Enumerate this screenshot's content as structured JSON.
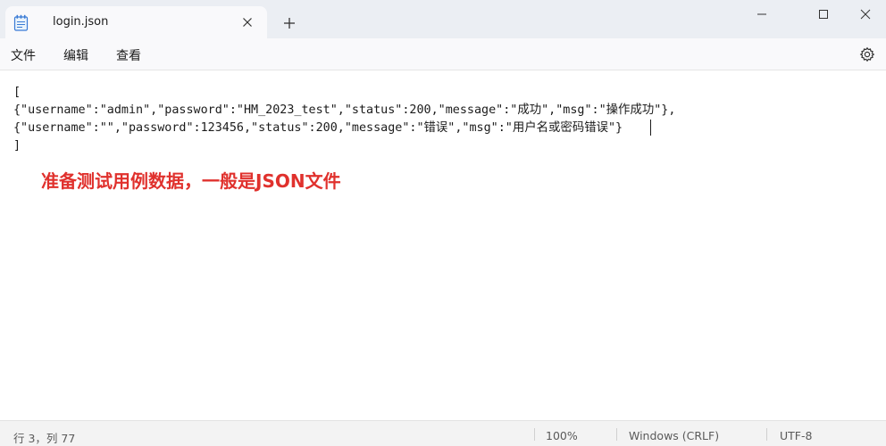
{
  "window": {
    "tab_title": "login.json",
    "new_tab_label": "+"
  },
  "menu": {
    "items": [
      "文件",
      "编辑",
      "查看"
    ]
  },
  "editor": {
    "lines": [
      "[",
      "{\"username\":\"admin\",\"password\":\"HM_2023_test\",\"status\":200,\"message\":\"成功\",\"msg\":\"操作成功\"},",
      "{\"username\":\"\",\"password\":123456,\"status\":200,\"message\":\"错误\",\"msg\":\"用户名或密码错误\"}",
      "]"
    ],
    "annotation": "准备测试用例数据，一般是JSON文件",
    "annotation_color": "#e0312d"
  },
  "status": {
    "position": "行 3，列 77",
    "zoom": "100%",
    "line_ending": "Windows (CRLF)",
    "encoding": "UTF-8"
  }
}
